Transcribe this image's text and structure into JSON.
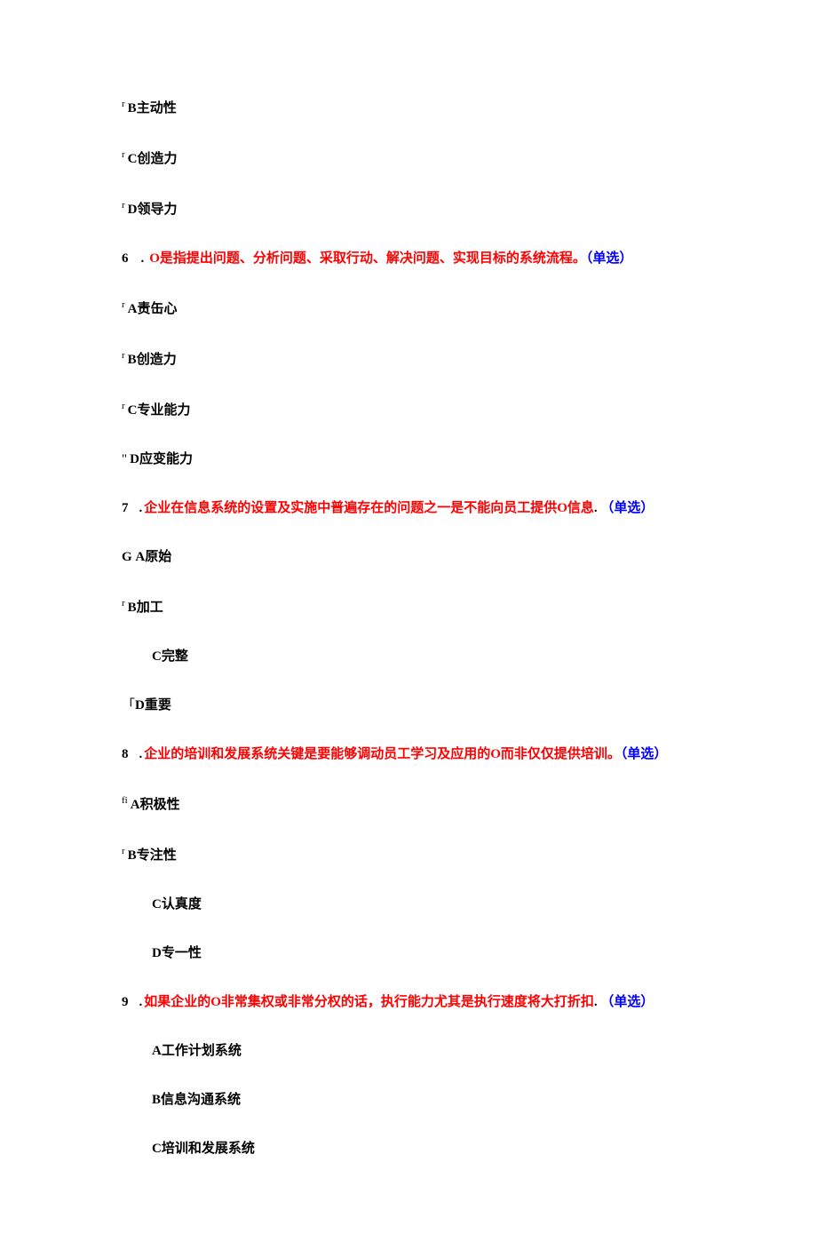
{
  "options_pre": [
    {
      "marker": "r",
      "letter": "B",
      "text": "主动性"
    },
    {
      "marker": "r",
      "letter": "C",
      "text": "创造力"
    },
    {
      "marker": "r",
      "letter": "D",
      "text": "领导力"
    }
  ],
  "q6": {
    "num": "6",
    "stem": "O是指提出问题、分析问题、采取行动、解决问题、实现目标的系统流程。",
    "tag": "（单选）",
    "options": [
      {
        "marker": "r",
        "letter": "A",
        "text": "责缶心"
      },
      {
        "marker": "r",
        "letter": "B",
        "text": "创造力"
      },
      {
        "marker": "r",
        "letter": "C",
        "text": "专业能力"
      },
      {
        "marker": "\"",
        "letter": "D",
        "text": "应变能力"
      }
    ]
  },
  "q7": {
    "num": "7",
    "stem": "企业在信息系统的设置及实施中普遍存在的问题之一是不能向员工提供O信息",
    "tail": ".",
    "tag": "（单选）",
    "options": [
      {
        "marker": "G",
        "letter": "A",
        "text": "原始",
        "big_marker": true
      },
      {
        "marker": "r",
        "letter": "B",
        "text": "加工"
      },
      {
        "marker": "",
        "letter": "C",
        "text": "完整",
        "indent": true
      },
      {
        "marker": "「",
        "letter": "D",
        "text": "重要",
        "big_marker": true
      }
    ]
  },
  "q8": {
    "num": "8",
    "stem": "企业的培训和发展系统关键是要能够调动员工学习及应用的O而非仅仅提供培训。",
    "tag": "（单选）",
    "options": [
      {
        "marker": "fi",
        "letter": "A",
        "text": "积极性"
      },
      {
        "marker": "r",
        "letter": "B",
        "text": "专注性"
      },
      {
        "marker": "",
        "letter": "C",
        "text": "认真度",
        "indent": true
      },
      {
        "marker": "",
        "letter": "D",
        "text": "专一性",
        "indent": true
      }
    ]
  },
  "q9": {
    "num": "9",
    "stem": "如果企业的O非常集权或非常分权的话，执行能力尤其是执行速度将大打折扣",
    "tail": ".",
    "tag": "（单选）",
    "options": [
      {
        "marker": "",
        "letter": "A",
        "text": "工作计划系统",
        "indent": true
      },
      {
        "marker": "",
        "letter": "B",
        "text": "信息沟通系统",
        "indent": true
      },
      {
        "marker": "",
        "letter": "C",
        "text": "培训和发展系统",
        "indent": true
      }
    ]
  }
}
